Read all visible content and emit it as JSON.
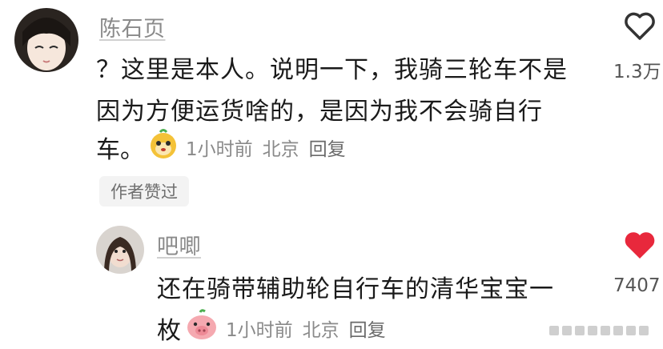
{
  "comments": [
    {
      "username": "陈石页",
      "lines": [
        "？这里是本人。说明一下，我骑三轮车不是",
        "因为方便运货啥的，是因为我不会骑自行"
      ],
      "last_line": "车。",
      "sticker": "monkey-face-sticker",
      "time": "1小时前",
      "location": "北京",
      "reply_label": "回复",
      "author_badge": "作者赞过",
      "likes": "1.3万",
      "liked": false
    },
    {
      "username": "吧唧",
      "lines": [
        "还在骑带辅助轮自行车的清华宝宝一"
      ],
      "last_line": "枚",
      "sticker": "pig-face-sticker",
      "time": "1小时前",
      "location": "北京",
      "reply_label": "回复",
      "likes": "7407",
      "liked": true
    }
  ],
  "colors": {
    "like_red": "#e8283c",
    "meta_gray": "#8a8a8a"
  }
}
